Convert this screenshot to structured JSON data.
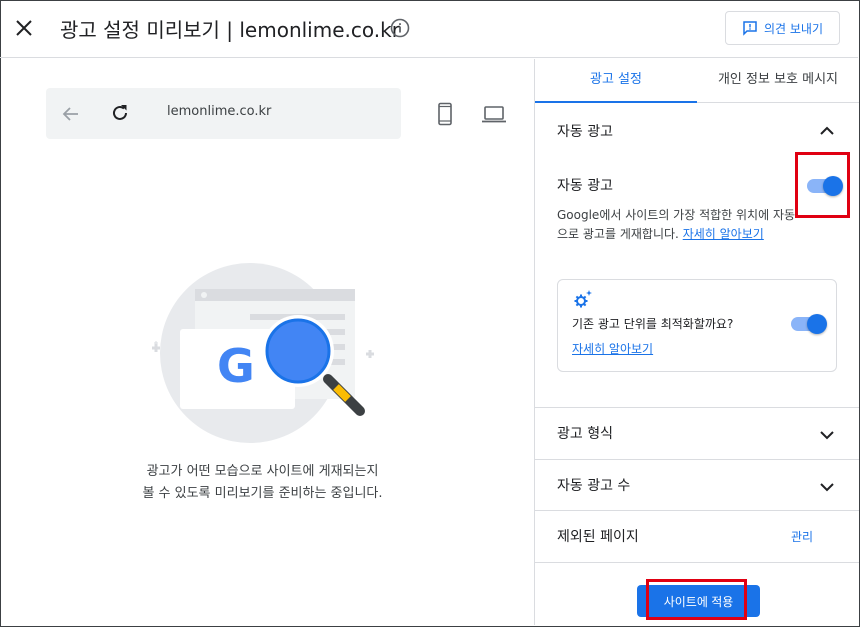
{
  "header": {
    "title": "광고 설정 미리보기 | lemonlime.co.kr",
    "feedback_label": "의견 보내기"
  },
  "preview": {
    "url": "lemonlime.co.kr",
    "message_line1": "광고가 어떤 모습으로 사이트에 게재되는지",
    "message_line2": "볼 수 있도록 미리보기를 준비하는 중입니다."
  },
  "tabs": [
    {
      "label": "광고 설정",
      "active": true
    },
    {
      "label": "개인 정보 보호 메시지",
      "active": false
    }
  ],
  "auto_ads": {
    "section_title": "자동 광고",
    "toggle_label": "자동 광고",
    "toggle_on": true,
    "description": "Google에서 사이트의 가장 적합한 위치에 자동으로 광고를 게재합니다.",
    "learn_more": "자세히 알아보기",
    "optimize": {
      "question": "기존 광고 단위를 최적화할까요?",
      "learn_more": "자세히 알아보기",
      "toggle_on": true
    }
  },
  "sections": {
    "ad_formats": "광고 형식",
    "ad_load": "자동 광고 수",
    "excluded_pages": "제외된 페이지",
    "manage_label": "관리"
  },
  "apply_label": "사이트에 적용",
  "colors": {
    "accent": "#1a73e8",
    "highlight": "#e00012"
  }
}
